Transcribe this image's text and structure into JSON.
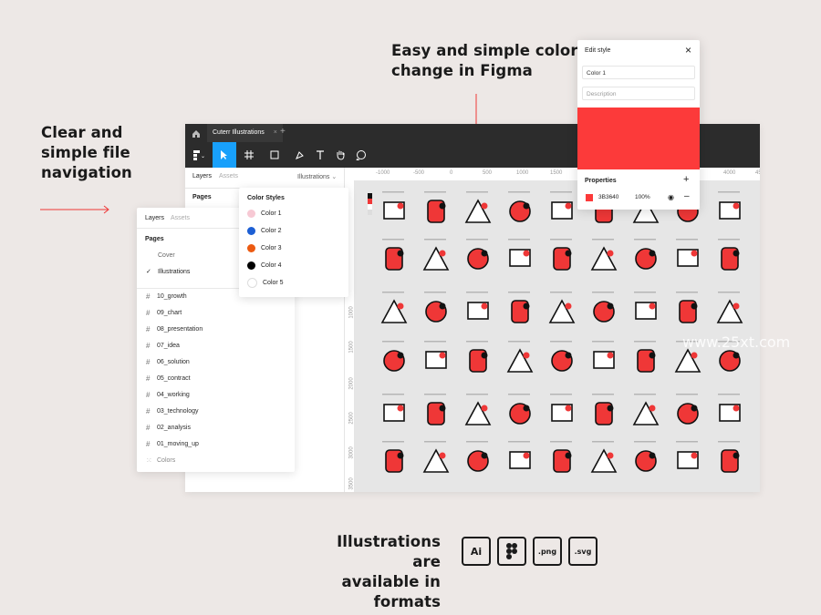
{
  "headlines": {
    "navigation": [
      "Clear and",
      "simple file",
      "navigation"
    ],
    "color_change": [
      "Easy and simple color",
      "change in Figma"
    ],
    "formats": [
      "Illustrations are",
      "available in formats"
    ]
  },
  "watermark": "www.25xt.com",
  "figma": {
    "tab_title": "Cuterr Illustrations",
    "left_tabs": [
      "Layers",
      "Assets"
    ],
    "page_dropdown": "Illustrations",
    "pages_label": "Pages",
    "ruler_top": [
      "-1000",
      "-500",
      "0",
      "500",
      "1000",
      "1500",
      "4000",
      "4500"
    ],
    "ruler_left": [
      "1000",
      "1500",
      "2000",
      "2500",
      "3000",
      "3500"
    ]
  },
  "layers_panel": {
    "tabs": [
      "Layers",
      "Assets"
    ],
    "pages_label": "Pages",
    "pages": [
      "Cover",
      "Illustrations"
    ],
    "selected_page": "Illustrations",
    "frames": [
      "10_growth",
      "09_chart",
      "08_presentation",
      "07_idea",
      "06_solution",
      "05_contract",
      "04_working",
      "03_technology",
      "02_analysis",
      "01_moving_up"
    ],
    "colors_item": "Colors"
  },
  "color_styles": {
    "title": "Color Styles",
    "items": [
      {
        "label": "Color 1",
        "color": "#f7c9d4"
      },
      {
        "label": "Color 2",
        "color": "#1c5fd4"
      },
      {
        "label": "Color 3",
        "color": "#ec5a11"
      },
      {
        "label": "Color 4",
        "color": "#000000"
      },
      {
        "label": "Color 5",
        "color": "#ffffff"
      }
    ]
  },
  "edit_style": {
    "title": "Edit style",
    "name_value": "Color 1",
    "description_placeholder": "Description",
    "swatch_color": "#fc3a3a",
    "properties_label": "Properties",
    "hex": "3B3640",
    "opacity": "100%"
  },
  "formats": [
    "Ai",
    "Figma",
    ".png",
    ".svg"
  ],
  "colors": {
    "accent": "#ef3737",
    "figma_blue": "#18a0fb",
    "dark": "#2c2c2c"
  },
  "icons": [
    "home-icon",
    "figma-menu-icon",
    "move-tool-icon",
    "frame-tool-icon",
    "rectangle-tool-icon",
    "pen-tool-icon",
    "text-tool-icon",
    "hand-tool-icon",
    "comment-tool-icon"
  ]
}
